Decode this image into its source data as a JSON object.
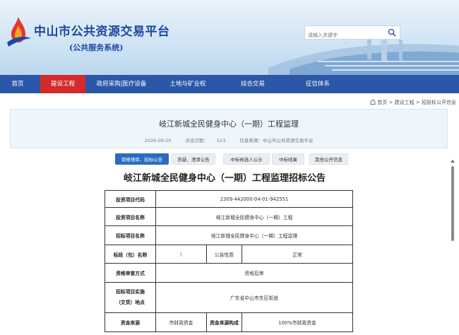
{
  "header": {
    "brand": "中山市公共资源交易平台",
    "sub_brand": "(公共服务系统)",
    "search_placeholder": "请输入关键字"
  },
  "nav": {
    "items": [
      {
        "label": "首页"
      },
      {
        "label": "建设工程"
      },
      {
        "label": "政府采购|医疗设备"
      },
      {
        "label": "土地与矿业权"
      },
      {
        "label": "综合交易"
      },
      {
        "label": "征信体系"
      }
    ],
    "active_index": 1
  },
  "breadcrumb": "首页 > 建设工程 > 招投标公开信息",
  "article": {
    "title": "岐江新城全民健身中心（一期）工程监理",
    "date": "2026-09-20",
    "views_label": "点击次数：",
    "views": "523",
    "source": "信息来源：中山市公共资源交易平台"
  },
  "tabs": [
    {
      "label": "资格预审、招标公告"
    },
    {
      "label": "答疑、澄清公告"
    },
    {
      "label": "中标候选人公示"
    },
    {
      "label": "中标结果"
    },
    {
      "label": "其他公开信息"
    }
  ],
  "announcement": {
    "title": "岐江新城全民健身中心（一期）工程监理招标公告",
    "labels": {
      "project_code": "投资项目代码",
      "project_name": "投资项目名称",
      "tender_name": "招标项目名称",
      "section_name": "标段（包）名称",
      "announce_nature": "公告性质",
      "qual_method": "资格审查方式",
      "location_line1": "招标项目实施",
      "location_line2": "（交货）地点",
      "fund_source": "资金来源",
      "fund_composition": "资金来源构成"
    },
    "values": {
      "project_code": "2309-442000-04-01-942551",
      "project_name": "岐江新城全民健身中心（一期）工程",
      "tender_name": "岐江新城全民健身中心（一期）工程监理",
      "section_name": "\\",
      "announce_nature": "正常",
      "qual_method": "资格后审",
      "location": "广东省中山市东区街道",
      "fund_source": "市财政资金",
      "fund_composition": "100%市财政资金"
    }
  }
}
